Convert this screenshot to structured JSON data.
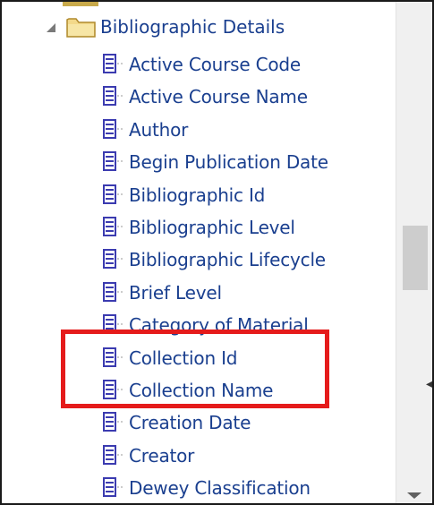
{
  "tree": {
    "parent": {
      "label": "Bibliographic Details",
      "icon": "folder-icon",
      "expanded": true
    },
    "children": [
      {
        "label": "Active Course Code"
      },
      {
        "label": "Active Course Name"
      },
      {
        "label": "Author"
      },
      {
        "label": "Begin Publication Date"
      },
      {
        "label": "Bibliographic Id"
      },
      {
        "label": "Bibliographic Level"
      },
      {
        "label": "Bibliographic Lifecycle"
      },
      {
        "label": "Brief Level"
      },
      {
        "label": "Category of Material"
      },
      {
        "label": "Collection Id"
      },
      {
        "label": "Collection Name"
      },
      {
        "label": "Creation Date"
      },
      {
        "label": "Creator"
      },
      {
        "label": "Dewey Classification"
      }
    ]
  },
  "highlight": {
    "color": "#e51b1b",
    "items": [
      "Collection Id",
      "Collection Name"
    ]
  },
  "colors": {
    "label": "#1a3f8f",
    "icon": "#3b3bb0",
    "folder": "#f3d98a"
  }
}
